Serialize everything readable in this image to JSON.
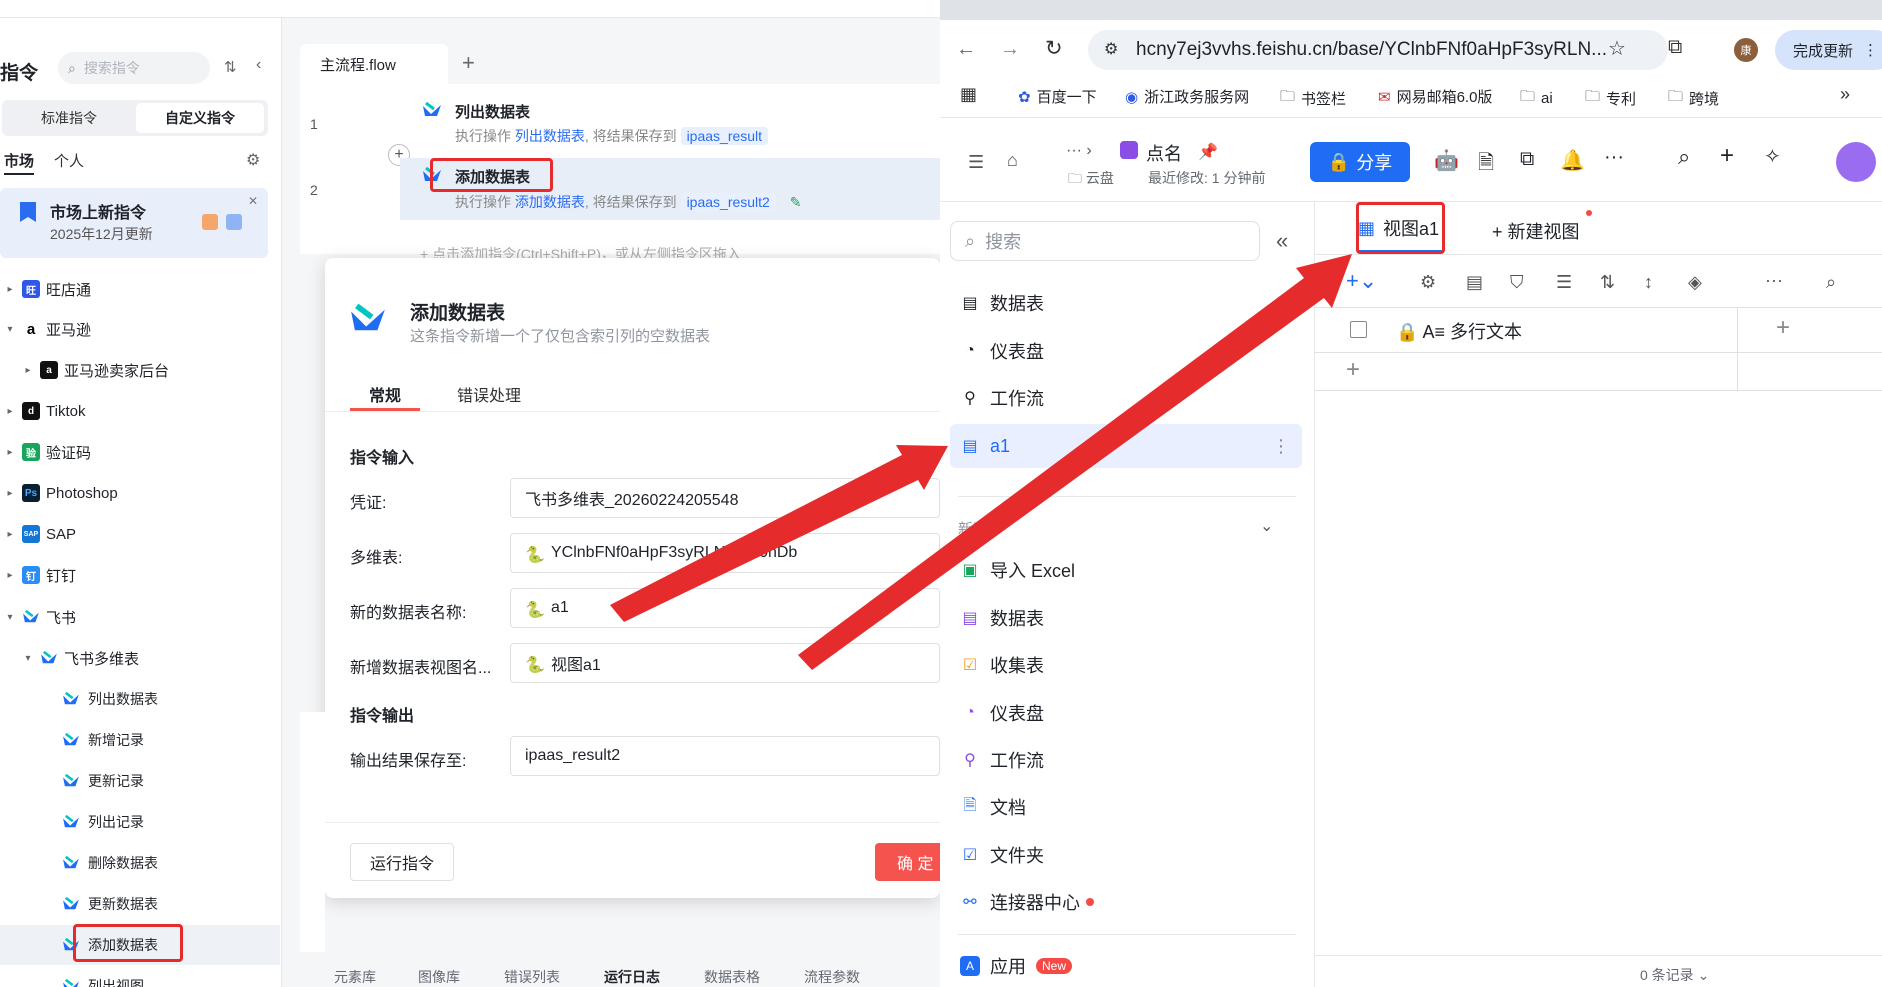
{
  "left_app": {
    "sidebar": {
      "title": "指令",
      "search_placeholder": "搜索指令",
      "segments": [
        "标准指令",
        "自定义指令"
      ],
      "subtabs": [
        "市场",
        "个人"
      ],
      "promo": {
        "title": "市场上新指令",
        "subtitle": "2025年12月更新"
      },
      "tree": [
        {
          "label": "旺店通",
          "logo": "旺"
        },
        {
          "label": "亚马逊",
          "logo": "a"
        },
        {
          "label": "亚马逊卖家后台",
          "logo": "a"
        },
        {
          "label": "Tiktok",
          "logo": "d"
        },
        {
          "label": "验证码",
          "logo": "验"
        },
        {
          "label": "Photoshop",
          "logo": "Ps"
        },
        {
          "label": "SAP",
          "logo": "SAP"
        },
        {
          "label": "钉钉",
          "logo": "钉"
        },
        {
          "label": "飞书",
          "logo": ""
        },
        {
          "label": "飞书多维表",
          "logo": ""
        },
        {
          "label": "列出数据表"
        },
        {
          "label": "新增记录"
        },
        {
          "label": "更新记录"
        },
        {
          "label": "列出记录"
        },
        {
          "label": "删除数据表"
        },
        {
          "label": "更新数据表"
        },
        {
          "label": "添加数据表"
        },
        {
          "label": "列出视图"
        }
      ]
    },
    "file_tab": "主流程.flow",
    "flow": {
      "steps": [
        {
          "no": "1",
          "title": "列出数据表",
          "prefix": "执行操作",
          "op": "列出数据表",
          "mid": ", 将结果保存到",
          "var": "ipaas_result"
        },
        {
          "no": "2",
          "title": "添加数据表",
          "prefix": "执行操作",
          "op": "添加数据表",
          "mid": ", 将结果保存到",
          "var": "ipaas_result2"
        }
      ],
      "hint": "+ 点击添加指令(Ctrl+Shift+P)，或从左侧指令区拖入"
    },
    "dialog": {
      "title": "添加数据表",
      "subtitle": "这条指令新增一个了仅包含索引列的空数据表",
      "tabs": [
        "常规",
        "错误处理"
      ],
      "section_input": "指令输入",
      "fields": [
        {
          "label": "凭证:",
          "value": "飞书多维表_20260224205548"
        },
        {
          "label": "多维表:",
          "value": "YClnbFNf0aHpF3syRLNc4xn0nDb"
        },
        {
          "label": "新的数据表名称:",
          "value": "a1"
        },
        {
          "label": "新增数据表视图名...",
          "value": "视图a1"
        }
      ],
      "section_output": "指令输出",
      "output_field": {
        "label": "输出结果保存至:",
        "value": "ipaas_result2"
      },
      "run_button": "运行指令",
      "confirm_button": "确 定"
    },
    "bottom_tabs": [
      "元素库",
      "图像库",
      "错误列表",
      "运行日志",
      "数据表格",
      "流程参数"
    ]
  },
  "browser": {
    "url": "hcny7ej3vvhs.feishu.cn/base/YClnbFNf0aHpF3syRLN...",
    "update_button": "完成更新",
    "avatar_text": "康",
    "bookmarks": [
      "百度一下",
      "浙江政务服务网",
      "书签栏",
      "网易邮箱6.0版",
      "ai",
      "专利",
      "跨境"
    ],
    "feishu": {
      "doc_title": "点名",
      "location": "云盘",
      "last_modified": "最近修改: 1 分钟前",
      "share_button": "分享",
      "search_placeholder": "搜索",
      "nav": [
        "数据表",
        "仪表盘",
        "工作流",
        "a1"
      ],
      "new_section": "新建",
      "new_items": [
        "导入 Excel",
        "数据表",
        "收集表",
        "仪表盘",
        "工作流",
        "文档",
        "文件夹",
        "连接器中心"
      ],
      "app_item": "应用",
      "new_badge": "New",
      "view_tab": "视图a1",
      "new_view": "新建视图",
      "column_header": "多行文本",
      "record_count": "0 条记录"
    }
  },
  "colors": {
    "accent": "#1f6df5",
    "annotation": "#e52b2b",
    "confirm": "#f5544e"
  }
}
